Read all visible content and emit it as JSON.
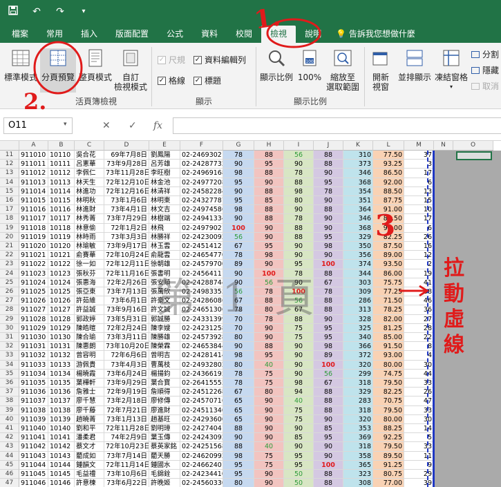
{
  "quick_access": {
    "save_icon": "save-icon",
    "undo_icon": "undo-icon",
    "redo_icon": "redo-icon",
    "customize_icon": "chevron-down-icon"
  },
  "tabs": [
    "檔案",
    "常用",
    "插入",
    "版面配置",
    "公式",
    "資料",
    "校閱",
    "檢視",
    "說明"
  ],
  "active_tab": "檢視",
  "tell_me": "告訴我您想做什麼",
  "ribbon": {
    "workbook_views": {
      "normal": "標準模式",
      "page_break_preview": "分頁預覽",
      "page_layout": "整頁模式",
      "custom_line1": "自訂",
      "custom_line2": "檢視模式",
      "group_label": "活頁簿檢視"
    },
    "show": {
      "ruler": "尺規",
      "formula_bar": "資料編輯列",
      "gridlines": "格線",
      "headings": "標題",
      "group_label": "顯示"
    },
    "zoom": {
      "zoom": "顯示比例",
      "hundred": "100%",
      "zoom_sel_line1": "縮放至",
      "zoom_sel_line2": "選取範圍",
      "group_label": "顯示比例"
    },
    "window": {
      "new_window_line1": "開新",
      "new_window_line2": "視窗",
      "arrange_all": "並排顯示",
      "freeze_panes": "凍結窗格",
      "split": "分割",
      "hide": "隱藏",
      "unhide": "取消"
    }
  },
  "formula_bar": {
    "name_box": "O11",
    "cancel": "✕",
    "enter": "✓",
    "fx": "fx",
    "value": ""
  },
  "columns": [
    "A",
    "B",
    "C",
    "D",
    "E",
    "F",
    "G",
    "H",
    "I",
    "J",
    "K",
    "L",
    "M",
    "N",
    "O"
  ],
  "column_colors": {
    "G": "#c6d9f0",
    "H": "#f2c4c0",
    "I": "#d8e6c4",
    "J": "#d4c8e2",
    "K": "#bfe3ec",
    "L": "#f9d2b4"
  },
  "watermark": "第 1 頁",
  "rows": [
    {
      "n": "11",
      "a": "911010",
      "b": "10110",
      "c": "吳合花",
      "d": "69年7月8日",
      "e": "劉鳳陽",
      "f": "02-24693021",
      "g": "78",
      "h": "88",
      "i": "56",
      "j": "88",
      "k": "310",
      "l": "77.50",
      "m": "37"
    },
    {
      "n": "12",
      "a": "911011",
      "b": "10111",
      "c": "呂憲華",
      "d": "73年9月28日",
      "e": "呂芳雄",
      "f": "02-24287732",
      "g": "90",
      "h": "95",
      "i": "90",
      "j": "88",
      "k": "373",
      "l": "93.25",
      "m": "3"
    },
    {
      "n": "13",
      "a": "911012",
      "b": "10112",
      "c": "李佩仁",
      "d": "73年11月28日",
      "e": "李旺樹",
      "f": "02-24969168",
      "g": "98",
      "h": "88",
      "i": "78",
      "j": "90",
      "k": "346",
      "l": "86.50",
      "m": "17"
    },
    {
      "n": "14",
      "a": "911013",
      "b": "10113",
      "c": "林天生",
      "d": "72年12月10日",
      "e": "林金池",
      "f": "02-24977208",
      "g": "95",
      "h": "90",
      "i": "88",
      "j": "95",
      "k": "368",
      "l": "92.00",
      "m": "6"
    },
    {
      "n": "15",
      "a": "911014",
      "b": "10114",
      "c": "林進功",
      "d": "72年12月16日",
      "e": "林清祥",
      "f": "02-24582284",
      "g": "90",
      "h": "88",
      "i": "98",
      "j": "78",
      "k": "354",
      "l": "88.50",
      "m": "13"
    },
    {
      "n": "16",
      "a": "911015",
      "b": "10115",
      "c": "林明秋",
      "d": "73年1月6日",
      "e": "林明東",
      "f": "02-24327787",
      "g": "95",
      "h": "85",
      "i": "80",
      "j": "90",
      "k": "351",
      "l": "87.75",
      "m": "15"
    },
    {
      "n": "17",
      "a": "911016",
      "b": "10116",
      "c": "林進財",
      "d": "73年4月1日",
      "e": "林文吉",
      "f": "02-24974586",
      "g": "98",
      "h": "88",
      "i": "90",
      "j": "88",
      "k": "364",
      "l": "91.00",
      "m": "10"
    },
    {
      "n": "18",
      "a": "911017",
      "b": "10117",
      "c": "林秀菁",
      "d": "73年7月29日",
      "e": "林樹端",
      "f": "02-24941334",
      "g": "90",
      "h": "88",
      "i": "78",
      "j": "90",
      "k": "346",
      "l": "86.50",
      "m": "17"
    },
    {
      "n": "19",
      "a": "911018",
      "b": "10118",
      "c": "林意偷",
      "d": "72年1月2日",
      "e": "林飛",
      "f": "02-24979021",
      "g": "100",
      "h": "90",
      "i": "88",
      "j": "90",
      "k": "368",
      "l": "92.00",
      "m": "6"
    },
    {
      "n": "20",
      "a": "911019",
      "b": "10119",
      "c": "林時雨",
      "d": "73年3月3日",
      "e": "林勝祥",
      "f": "02-24230092",
      "g": "56",
      "h": "90",
      "i": "88",
      "j": "95",
      "k": "329",
      "l": "82.25",
      "m": "26"
    },
    {
      "n": "21",
      "a": "911020",
      "b": "10120",
      "c": "林瑜敏",
      "d": "73年9月17日",
      "e": "林玉雲",
      "f": "02-24514121",
      "g": "67",
      "h": "95",
      "i": "90",
      "j": "98",
      "k": "350",
      "l": "87.50",
      "m": "16"
    },
    {
      "n": "22",
      "a": "911021",
      "b": "10121",
      "c": "俞賽華",
      "d": "72年10月24日",
      "e": "俞龍雲",
      "f": "02-24654770",
      "g": "78",
      "h": "98",
      "i": "90",
      "j": "90",
      "k": "356",
      "l": "89.00",
      "m": "12"
    },
    {
      "n": "23",
      "a": "911022",
      "b": "10122",
      "c": "徐一如",
      "d": "72年12月11日",
      "e": "徐朝雄",
      "f": "02-24579700",
      "g": "89",
      "h": "90",
      "i": "95",
      "j": "100",
      "k": "374",
      "l": "93.50",
      "m": "2"
    },
    {
      "n": "24",
      "a": "911023",
      "b": "10123",
      "c": "張秋芬",
      "d": "72年11月16日",
      "e": "張書明",
      "f": "02-24564111",
      "g": "90",
      "h": "100",
      "i": "78",
      "j": "88",
      "k": "344",
      "l": "86.00",
      "m": "19"
    },
    {
      "n": "25",
      "a": "911024",
      "b": "10124",
      "c": "張惠海",
      "d": "72年2月26日",
      "e": "張安順",
      "f": "02-24288744",
      "g": "90",
      "h": "56",
      "i": "90",
      "j": "67",
      "k": "303",
      "l": "75.75",
      "m": "41"
    },
    {
      "n": "26",
      "a": "911025",
      "b": "10125",
      "c": "張亞東",
      "d": "73年7月13日",
      "e": "張萬欣",
      "f": "02-24983355",
      "g": "56",
      "h": "78",
      "i": "100",
      "j": "78",
      "k": "309",
      "l": "77.25",
      "m": "38"
    },
    {
      "n": "27",
      "a": "911026",
      "b": "10126",
      "c": "許茹維",
      "d": "73年6月1日",
      "e": "許豪文",
      "f": "02-24286086",
      "g": "67",
      "h": "88",
      "i": "56",
      "j": "88",
      "k": "286",
      "l": "71.50",
      "m": "46"
    },
    {
      "n": "28",
      "a": "911027",
      "b": "10127",
      "c": "許益誠",
      "d": "73年9月16日",
      "e": "許文誠",
      "f": "02-24651306",
      "g": "78",
      "h": "80",
      "i": "67",
      "j": "88",
      "k": "313",
      "l": "78.25",
      "m": "36"
    },
    {
      "n": "29",
      "a": "911028",
      "b": "10128",
      "c": "郭政婷",
      "d": "73年5月31日",
      "e": "郭誠勝",
      "f": "02-24331399",
      "g": "70",
      "h": "78",
      "i": "88",
      "j": "90",
      "k": "328",
      "l": "82.00",
      "m": "27"
    },
    {
      "n": "30",
      "a": "911029",
      "b": "10129",
      "c": "陳皓暄",
      "d": "72年2月24日",
      "e": "陳李嫂",
      "f": "02-24231258",
      "g": "70",
      "h": "90",
      "i": "75",
      "j": "95",
      "k": "325",
      "l": "81.25",
      "m": "28"
    },
    {
      "n": "31",
      "a": "911030",
      "b": "10130",
      "c": "陳合瑜",
      "d": "73年3月11日",
      "e": "陳勝雄",
      "f": "02-24573928",
      "g": "80",
      "h": "90",
      "i": "75",
      "j": "95",
      "k": "340",
      "l": "85.00",
      "m": "22"
    },
    {
      "n": "32",
      "a": "911031",
      "b": "10131",
      "c": "陳惠朗",
      "d": "73年10月20日",
      "e": "陳榮霖",
      "f": "02-24653844",
      "g": "90",
      "h": "88",
      "i": "90",
      "j": "98",
      "k": "366",
      "l": "91.50",
      "m": "8"
    },
    {
      "n": "33",
      "a": "911032",
      "b": "10132",
      "c": "曾容明",
      "d": "72年6月6日",
      "e": "曾明吉",
      "f": "02-24281414",
      "g": "98",
      "h": "95",
      "i": "90",
      "j": "89",
      "k": "372",
      "l": "93.00",
      "m": "4"
    },
    {
      "n": "34",
      "a": "911033",
      "b": "10133",
      "c": "游佩貴",
      "d": "73年4月3日",
      "e": "曹萬枝",
      "f": "02-24932802",
      "g": "80",
      "h": "40",
      "i": "90",
      "j": "100",
      "k": "320",
      "l": "80.00",
      "m": "30"
    },
    {
      "n": "35",
      "a": "911034",
      "b": "10134",
      "c": "楊曉霞",
      "d": "73年6月24日",
      "e": "楊揚鈞",
      "f": "02-24366195",
      "g": "78",
      "h": "75",
      "i": "90",
      "j": "56",
      "k": "299",
      "l": "74.75",
      "m": "44"
    },
    {
      "n": "36",
      "a": "911035",
      "b": "10135",
      "c": "葉樺軒",
      "d": "73年9月29日",
      "e": "葉合寶",
      "f": "02-26415555",
      "g": "78",
      "h": "75",
      "i": "98",
      "j": "67",
      "k": "318",
      "l": "79.50",
      "m": "33"
    },
    {
      "n": "37",
      "a": "911036",
      "b": "10136",
      "c": "詹雅士",
      "d": "72年9月19日",
      "e": "詹順得",
      "f": "02-24512268",
      "g": "67",
      "h": "80",
      "i": "94",
      "j": "88",
      "k": "329",
      "l": "82.25",
      "m": "26"
    },
    {
      "n": "38",
      "a": "911037",
      "b": "10137",
      "c": "廖千慧",
      "d": "73年2月18日",
      "e": "廖修傳",
      "f": "02-24570716",
      "g": "65",
      "h": "90",
      "i": "40",
      "j": "88",
      "k": "283",
      "l": "70.75",
      "m": "47"
    },
    {
      "n": "39",
      "a": "911038",
      "b": "10138",
      "c": "廖千藤",
      "d": "72年7月21日",
      "e": "廖進財",
      "f": "02-24511340",
      "g": "65",
      "h": "90",
      "i": "75",
      "j": "88",
      "k": "318",
      "l": "79.50",
      "m": "33"
    },
    {
      "n": "40",
      "a": "911039",
      "b": "10139",
      "c": "趙曉菁",
      "d": "73年1月13日",
      "e": "趙基旺",
      "f": "02-24293600",
      "g": "65",
      "h": "90",
      "i": "75",
      "j": "90",
      "k": "320",
      "l": "80.00",
      "m": "30"
    },
    {
      "n": "41",
      "a": "911040",
      "b": "10140",
      "c": "劉和平",
      "d": "72年11月28日",
      "e": "劉明璋",
      "f": "02-24274041",
      "g": "88",
      "h": "90",
      "i": "90",
      "j": "85",
      "k": "353",
      "l": "88.25",
      "m": "14"
    },
    {
      "n": "42",
      "a": "911041",
      "b": "10141",
      "c": "潘柔君",
      "d": "74年2月9日",
      "e": "葉玉傳",
      "f": "02-24243092",
      "g": "90",
      "h": "90",
      "i": "85",
      "j": "95",
      "k": "369",
      "l": "92.25",
      "m": "5"
    },
    {
      "n": "43",
      "a": "911042",
      "b": "10142",
      "c": "蔡文才",
      "d": "72年10月23日",
      "e": "蔡英家銘",
      "f": "02-24251568",
      "g": "88",
      "h": "40",
      "i": "90",
      "j": "90",
      "k": "318",
      "l": "79.50",
      "m": "33"
    },
    {
      "n": "44",
      "a": "911043",
      "b": "10143",
      "c": "藺成如",
      "d": "73年7月14日",
      "e": "藺天勝",
      "f": "02-24620992",
      "g": "98",
      "h": "75",
      "i": "95",
      "j": "90",
      "k": "358",
      "l": "89.50",
      "m": "11"
    },
    {
      "n": "45",
      "a": "911044",
      "b": "10144",
      "c": "鍾韻文",
      "d": "72年11月14日",
      "e": "鍾國水",
      "f": "02-24662401",
      "g": "95",
      "h": "75",
      "i": "95",
      "j": "100",
      "k": "365",
      "l": "91.25",
      "m": "9"
    },
    {
      "n": "46",
      "a": "911045",
      "b": "10145",
      "c": "毛益禮",
      "d": "73年10月6日",
      "e": "毛錦銓",
      "f": "02-24234410",
      "g": "95",
      "h": "90",
      "i": "50",
      "j": "88",
      "k": "323",
      "l": "80.75",
      "m": "29"
    },
    {
      "n": "47",
      "a": "911046",
      "b": "10146",
      "c": "許意楝",
      "d": "73年6月22日",
      "e": "許晚姬",
      "f": "02-24560330",
      "g": "80",
      "h": "90",
      "i": "50",
      "j": "88",
      "k": "308",
      "l": "77.00",
      "m": "39"
    }
  ],
  "annotations": {
    "drag_text": "拉\n動\n虛\n線",
    "step1": "1.",
    "step2": "2.",
    "step3": "3"
  },
  "accent_red": "#e01b1b",
  "excel_green": "#217346",
  "page_break_blue": "#1f37c4"
}
